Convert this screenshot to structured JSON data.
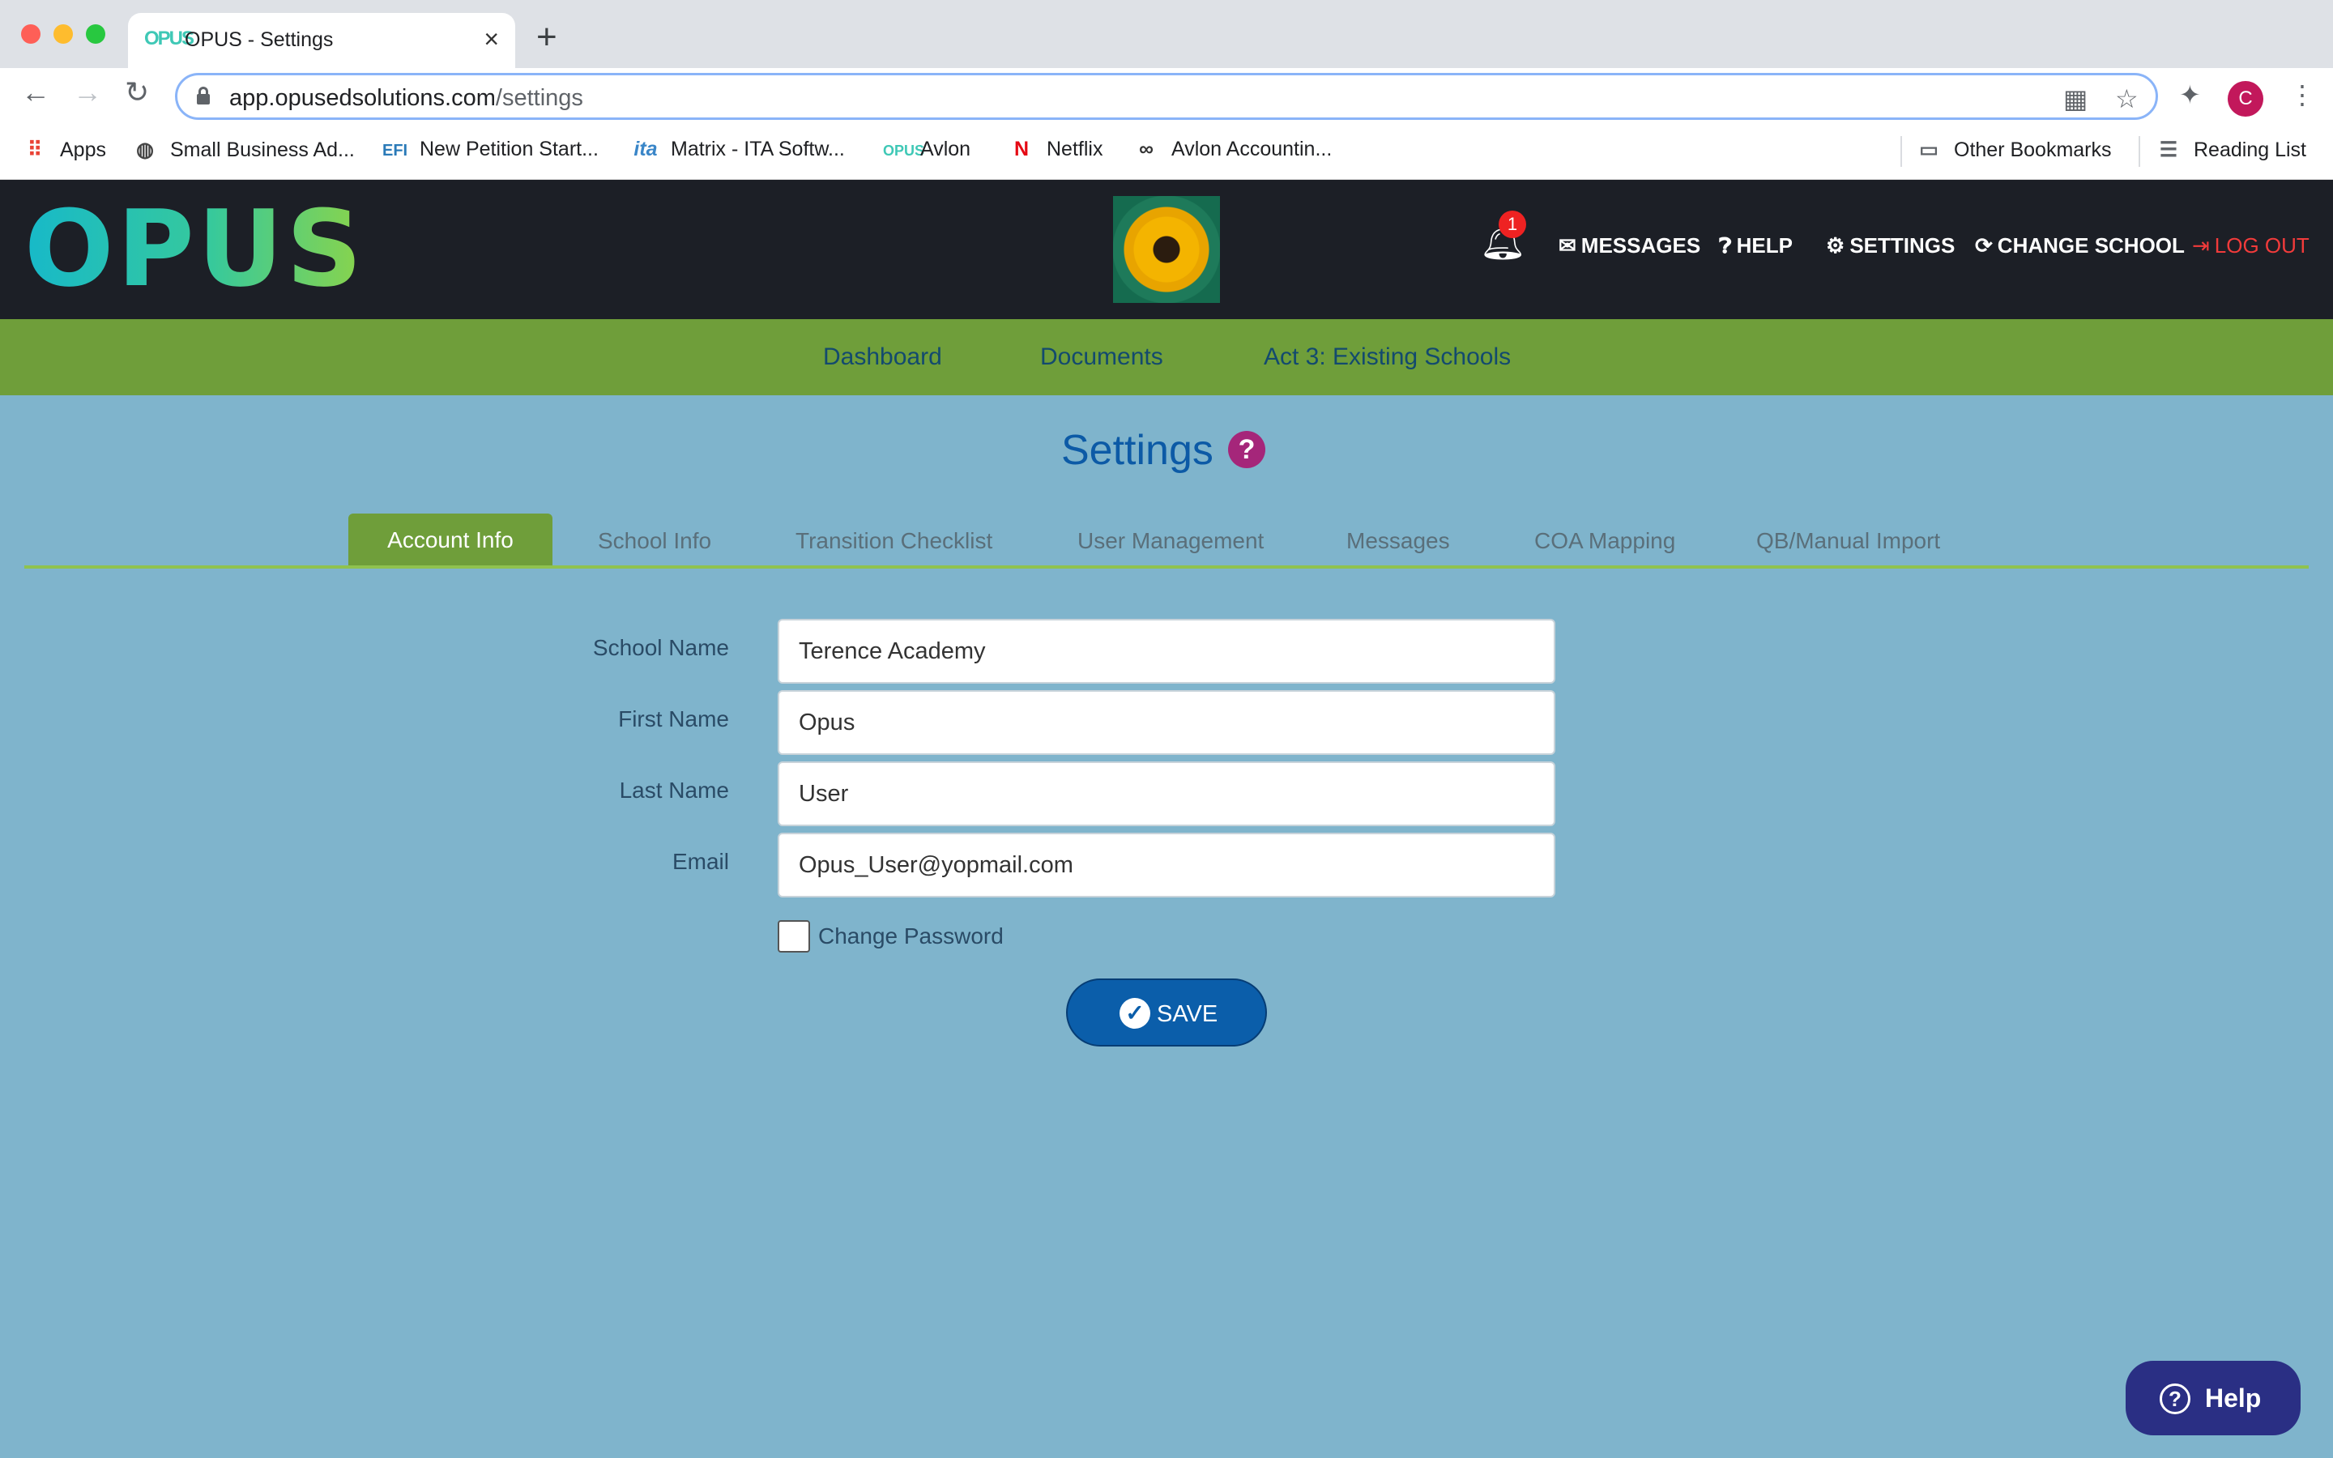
{
  "browser": {
    "tab_title": "OPUS - Settings",
    "tab_favicon": "OPUS",
    "url_host": "app.opusedsolutions.com",
    "url_path": "/settings",
    "profile_initial": "C",
    "bookmarks": [
      {
        "label": "Apps",
        "icon": "apps-grid-icon"
      },
      {
        "label": "Small Business Ad...",
        "icon": "globe-icon"
      },
      {
        "label": "New Petition Start...",
        "icon": "efi-icon"
      },
      {
        "label": "Matrix - ITA Softw...",
        "icon": "ita-icon"
      },
      {
        "label": "Avlon",
        "icon": "opus-icon"
      },
      {
        "label": "Netflix",
        "icon": "netflix-icon"
      },
      {
        "label": "Avlon Accountin...",
        "icon": "binoculars-icon"
      }
    ],
    "other_bookmarks": "Other Bookmarks",
    "reading_list": "Reading List"
  },
  "header": {
    "logo_text": "OPUS",
    "notification_count": "1",
    "nav": {
      "messages": "MESSAGES",
      "help": "HELP",
      "settings": "SETTINGS",
      "change_school": "CHANGE SCHOOL",
      "logout": "LOG OUT"
    }
  },
  "main_nav": {
    "dashboard": "Dashboard",
    "documents": "Documents",
    "act3": "Act 3: Existing Schools"
  },
  "page": {
    "title": "Settings",
    "help_glyph": "?"
  },
  "settings_tabs": [
    {
      "label": "Account Info",
      "active": true
    },
    {
      "label": "School Info"
    },
    {
      "label": "Transition Checklist"
    },
    {
      "label": "User Management"
    },
    {
      "label": "Messages"
    },
    {
      "label": "COA Mapping"
    },
    {
      "label": "QB/Manual Import"
    }
  ],
  "form": {
    "school_name": {
      "label": "School Name",
      "value": "Terence Academy"
    },
    "first_name": {
      "label": "First Name",
      "value": "Opus"
    },
    "last_name": {
      "label": "Last Name",
      "value": "User"
    },
    "email": {
      "label": "Email",
      "value": "Opus_User@yopmail.com"
    },
    "change_password": {
      "label": "Change Password",
      "checked": false
    },
    "save_label": "SAVE"
  },
  "help_widget": {
    "label": "Help"
  },
  "colors": {
    "page_bg": "#7fb4cc",
    "header_bg": "#1c1f26",
    "nav_green": "#6f9e3a",
    "primary_blue": "#0b5eaa",
    "logout_red": "#f23b3b"
  }
}
